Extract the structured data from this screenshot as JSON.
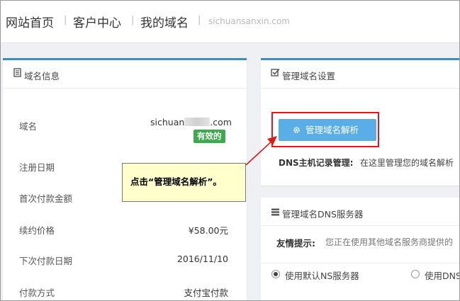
{
  "breadcrumb": {
    "items": [
      "网站首页",
      "客户中心",
      "我的域名"
    ],
    "separator": "|",
    "domain": "sichuansanxin.com"
  },
  "domain_info": {
    "title": "域名信息",
    "rows": [
      {
        "label": "域名",
        "value_prefix": "sichuan",
        "value_suffix": ".com"
      },
      {
        "label": "注册日期",
        "value": ""
      },
      {
        "label": "首次付款金额",
        "value": ""
      },
      {
        "label": "续约价格",
        "value": "¥58.00元"
      },
      {
        "label": "下次付款日期",
        "value": "2016/11/10"
      },
      {
        "label": "付款方式",
        "value": "支付宝付款"
      }
    ],
    "status_badge": "有效的"
  },
  "manage": {
    "title": "管理域名设置",
    "button_label": "管理域名解析",
    "dns_record_title": "DNS主机记录管理:",
    "dns_record_desc": "在这里管理您的域名解析"
  },
  "dns_servers": {
    "title": "管理域名DNS服务器",
    "tip_label": "友情提示:",
    "tip_text": "您正在使用其他域名服务商提供的",
    "options": [
      {
        "label": "使用默认NS服务器",
        "selected": true
      },
      {
        "label": "使用DNS",
        "selected": false
      }
    ]
  },
  "annotation": {
    "callout_text": "点击“管理域名解析”。"
  },
  "colors": {
    "panel_accent": "#3c8dbc",
    "button": "#5aaee8",
    "badge": "#3eaa4f",
    "highlight": "#e01a1a",
    "callout_bg": "#ffffcc"
  }
}
